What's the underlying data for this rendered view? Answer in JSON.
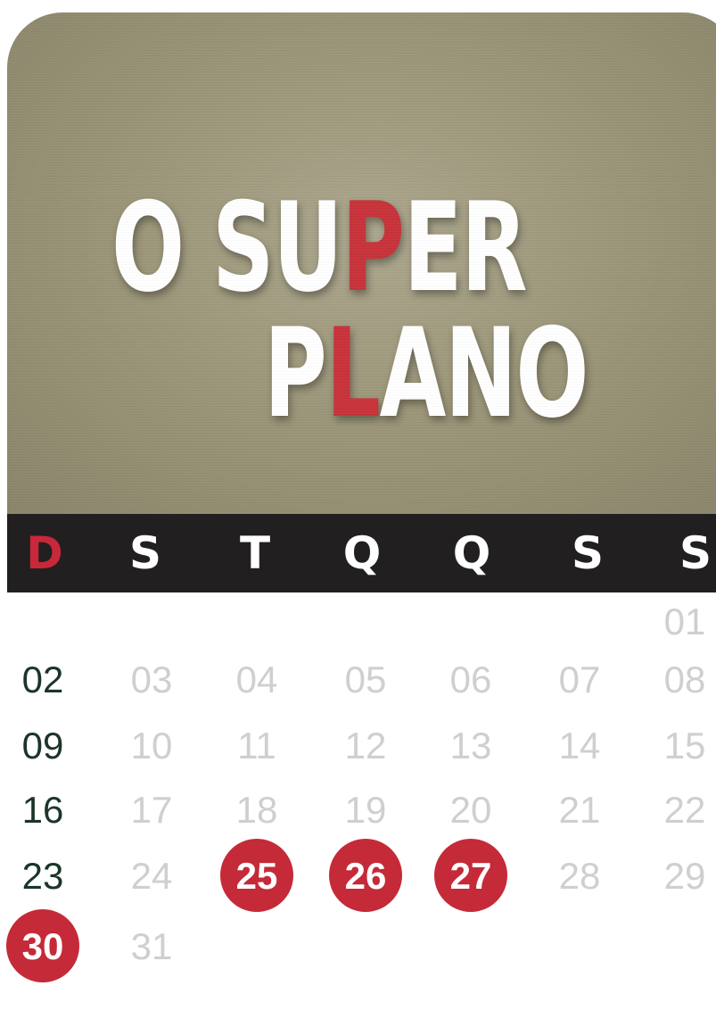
{
  "title": {
    "line1_pre": "O SU",
    "line1_accent": "P",
    "line1_post": "ER",
    "line2_pre": "P",
    "line2_accent": "L",
    "line2_post": "ANO"
  },
  "weekdays": [
    "D",
    "S",
    "T",
    "Q",
    "Q",
    "S",
    "S"
  ],
  "calendar": {
    "weeks": [
      [
        "",
        "",
        "",
        "",
        "",
        "",
        "01"
      ],
      [
        "02",
        "03",
        "04",
        "05",
        "06",
        "07",
        "08"
      ],
      [
        "09",
        "10",
        "11",
        "12",
        "13",
        "14",
        "15"
      ],
      [
        "16",
        "17",
        "18",
        "19",
        "20",
        "21",
        "22"
      ],
      [
        "23",
        "24",
        "25",
        "26",
        "27",
        "28",
        "29"
      ],
      [
        "30",
        "31",
        "",
        "",
        "",
        "",
        ""
      ]
    ],
    "highlighted": [
      "25",
      "26",
      "27",
      "30"
    ]
  },
  "colors": {
    "accent": "#c8323a",
    "header_background": "#221f20",
    "sunday_text": "#1c3529",
    "inactive_text": "#cfcfcf",
    "poster_background": "#9c9679"
  }
}
